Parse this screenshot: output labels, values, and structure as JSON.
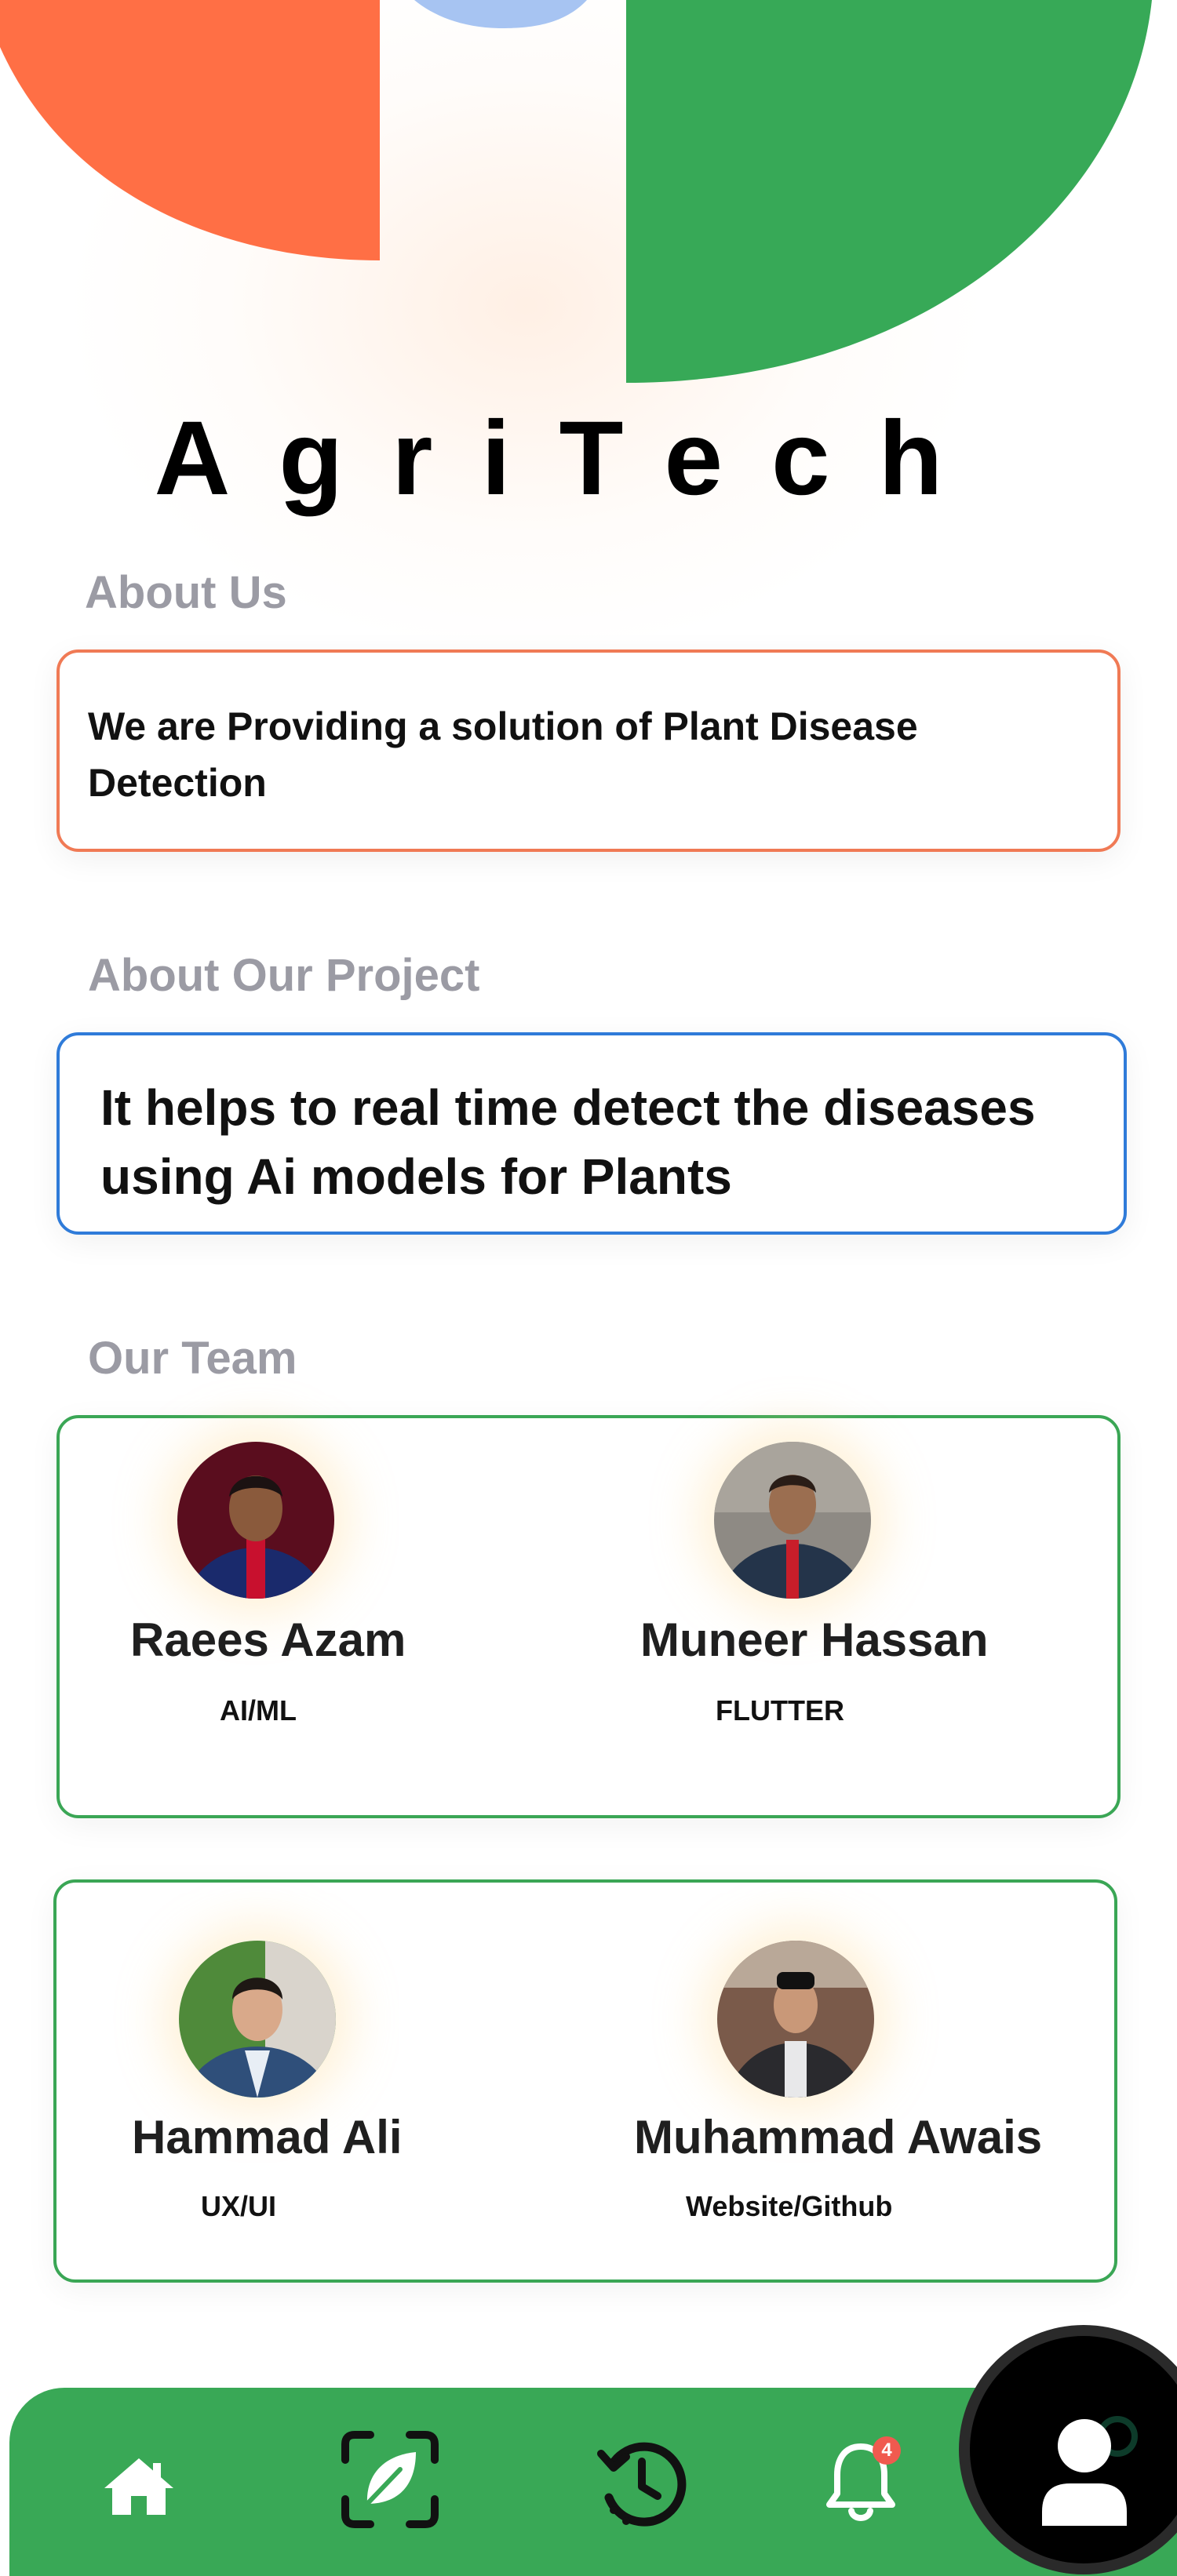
{
  "app": {
    "title": "AgriTech"
  },
  "colors": {
    "brand_green": "#39a856",
    "logo_orange": "#ff6f45",
    "logo_green": "#37a957",
    "logo_blue": "#a7c4f2",
    "about_border": "#f07a55",
    "project_border": "#2f7bd9",
    "team_border": "#3aa655",
    "label_gray": "#9b9ba4",
    "badge_red": "#f05a4f"
  },
  "about": {
    "label": "About Us",
    "text": "We are Providing a solution of Plant Disease Detection"
  },
  "project": {
    "label": "About Our Project",
    "text": "It helps to real time detect the diseases using Ai models for Plants"
  },
  "team": {
    "label": "Our Team",
    "members": [
      {
        "name": "Raees Azam",
        "role": "AI/ML"
      },
      {
        "name": "Muneer Hassan",
        "role": "FLUTTER"
      },
      {
        "name": "Hammad Ali",
        "role": "UX/UI"
      },
      {
        "name": "Muhammad Awais",
        "role": "Website/Github"
      }
    ]
  },
  "nav": {
    "items": [
      {
        "icon": "home-icon"
      },
      {
        "icon": "leaf-scan-icon"
      },
      {
        "icon": "history-icon"
      },
      {
        "icon": "bell-icon",
        "badge": "4"
      },
      {
        "icon": "profile-icon",
        "active": true
      }
    ]
  }
}
